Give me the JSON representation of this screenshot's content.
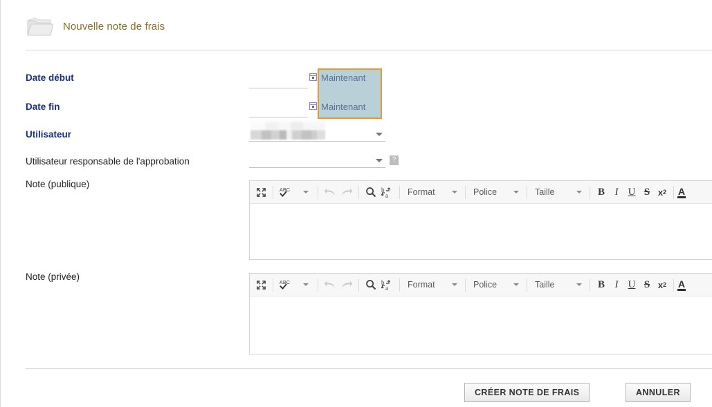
{
  "header": {
    "title": "Nouvelle note de frais",
    "icon": "folder-icon"
  },
  "form": {
    "fields": [
      {
        "label": "Date début",
        "required": true,
        "type": "date",
        "value": "",
        "calendar_icon": "calendar-icon",
        "now_link": "Maintenant"
      },
      {
        "label": "Date fin",
        "required": true,
        "type": "date",
        "value": "",
        "calendar_icon": "calendar-icon",
        "now_link": "Maintenant"
      },
      {
        "label": "Utilisateur",
        "required": true,
        "type": "select",
        "value": "",
        "value_redacted": true
      },
      {
        "label": "Utilisateur responsable de l'approbation",
        "required": false,
        "type": "select",
        "value": "",
        "help_icon": "?"
      }
    ]
  },
  "editors": [
    {
      "label": "Note (publique)",
      "content": "",
      "toolbar": {
        "maximize": "maximize-icon",
        "spellcheck": "ABC",
        "undo": "undo-icon",
        "redo": "redo-icon",
        "find": "search-icon",
        "replace": "replace-icon",
        "format": "Format",
        "font": "Police",
        "size": "Taille",
        "bold": "B",
        "italic": "I",
        "underline": "U",
        "strike": "S",
        "superscript": "x",
        "superscript_exp": "2",
        "text_color": "A"
      }
    },
    {
      "label": "Note (privée)",
      "content": "",
      "toolbar": {
        "maximize": "maximize-icon",
        "spellcheck": "ABC",
        "undo": "undo-icon",
        "redo": "redo-icon",
        "find": "search-icon",
        "replace": "replace-icon",
        "format": "Format",
        "font": "Police",
        "size": "Taille",
        "bold": "B",
        "italic": "I",
        "underline": "U",
        "strike": "S",
        "superscript": "x",
        "superscript_exp": "2",
        "text_color": "A"
      }
    }
  ],
  "footer": {
    "submit_label": "CRÉER NOTE DE FRAIS",
    "cancel_label": "ANNULER"
  },
  "selection": {
    "highlight_border_color": "#e39b2e",
    "highlight_fill_color": "rgba(130,170,186,0.55)"
  },
  "colors": {
    "title": "#8a6d1f",
    "required_label": "#1a2f7a",
    "link": "#1d2d6b"
  }
}
